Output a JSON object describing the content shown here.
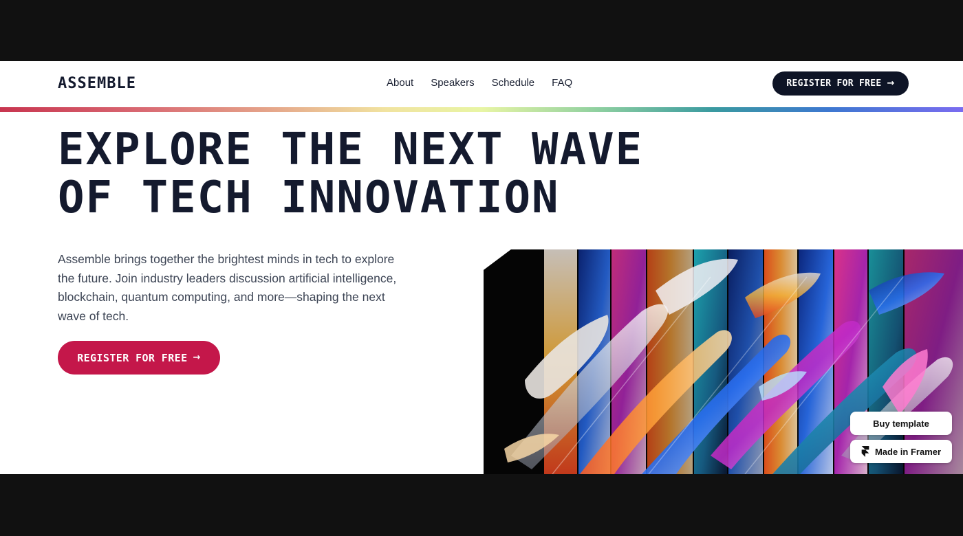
{
  "nav": {
    "logo": "ASSEMBLE",
    "links": [
      {
        "label": "About"
      },
      {
        "label": "Speakers"
      },
      {
        "label": "Schedule"
      },
      {
        "label": "FAQ"
      }
    ],
    "cta_label": "REGISTER FOR FREE"
  },
  "hero": {
    "headline_line1": "EXPLORE THE NEXT WAVE",
    "headline_line2": "OF TECH INNOVATION",
    "intro": "Assemble brings together the brightest minds in tech to explore the future. Join industry leaders discussion artificial intelligence, blockchain, quantum computing, and more—shaping the next wave of tech.",
    "cta_label": "REGISTER FOR FREE"
  },
  "badges": {
    "buy_label": "Buy template",
    "framer_label": "Made in Framer"
  },
  "icons": {
    "cta_arrow": "arrow-right-icon",
    "framer": "framer-logo-icon"
  },
  "colors": {
    "ink": "#141a2e",
    "nav_cta_bg": "#0e1426",
    "hero_cta_bg": "#c4174a",
    "page_bg": "#ffffff",
    "letterbox": "#111111"
  }
}
